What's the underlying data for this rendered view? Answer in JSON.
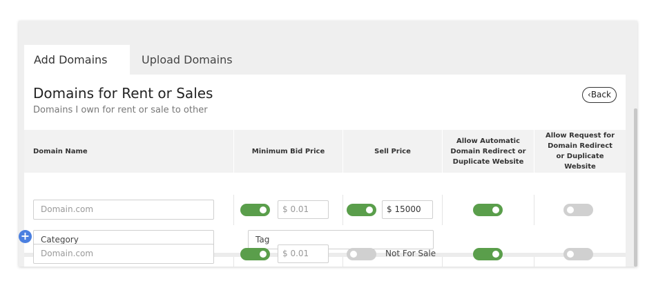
{
  "tabs": [
    {
      "label": "Add Domains",
      "active": true
    },
    {
      "label": "Upload Domains",
      "active": false
    }
  ],
  "panel": {
    "title": "Domains for Rent or Sales",
    "subtitle": "Domains I own for rent or sale to other",
    "back_label": "Back"
  },
  "table": {
    "headers": {
      "domain_name": "Domain Name",
      "min_bid": "Minimum Bid Price",
      "sell_price": "Sell Price",
      "allow_auto": "Allow Automatic Domain Redirect or Duplicate Website",
      "allow_request": "Allow Request for Domain Redirect or Duplicate Website"
    },
    "rows": [
      {
        "domain_placeholder": "Domain.com",
        "min_bid_on": true,
        "min_bid_placeholder": "$ 0.01",
        "sell_on": true,
        "sell_value": "$ 15000",
        "allow_auto_on": true,
        "allow_request_on": false,
        "category_placeholder": "Category",
        "tag_placeholder": "Tag"
      },
      {
        "domain_placeholder": "Domain.com",
        "min_bid_on": true,
        "min_bid_placeholder": "$ 0.01",
        "sell_on": false,
        "sell_text": "Not For Sale",
        "allow_auto_on": true,
        "allow_request_on": false
      }
    ]
  },
  "icons": {
    "back": "chevron-left-icon",
    "add": "plus-icon"
  },
  "colors": {
    "toggle_on": "#5a9e4b",
    "toggle_off": "#d0d0d0",
    "add_button": "#4a7fe0"
  }
}
